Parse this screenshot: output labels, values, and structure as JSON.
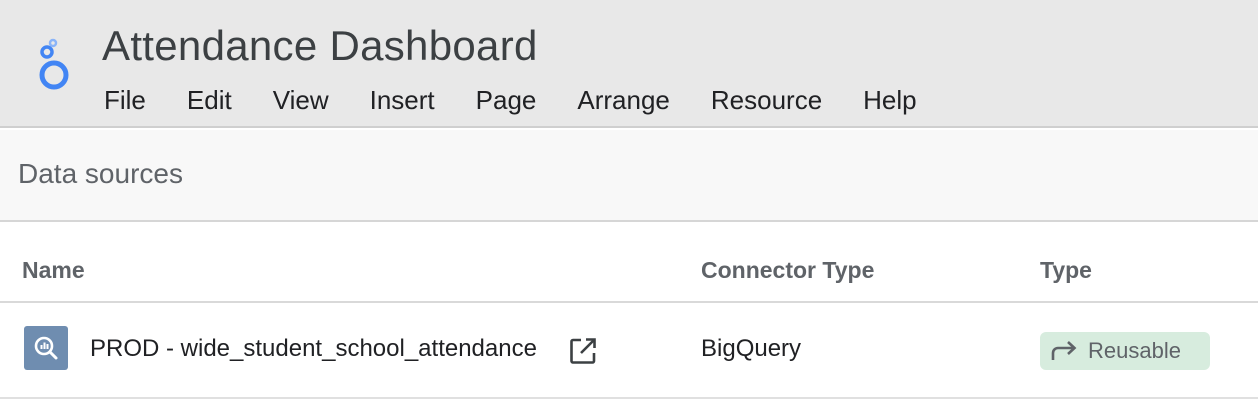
{
  "app": {
    "title": "Attendance Dashboard",
    "logo_icon": "looker-studio-logo-icon",
    "accent_color": "#4285f4"
  },
  "menu": {
    "items": [
      "File",
      "Edit",
      "View",
      "Insert",
      "Page",
      "Arrange",
      "Resource",
      "Help"
    ]
  },
  "panel": {
    "title": "Data sources"
  },
  "table": {
    "columns": [
      "Name",
      "Connector Type",
      "Type"
    ],
    "rows": [
      {
        "icon": "bigquery-icon",
        "name": "PROD - wide_student_school_attendance",
        "name_action_icon": "open-in-new-icon",
        "connector": "BigQuery",
        "type_icon": "share-arrow-icon",
        "type": "Reusable",
        "type_badge_color": "#d7ecde"
      }
    ]
  }
}
